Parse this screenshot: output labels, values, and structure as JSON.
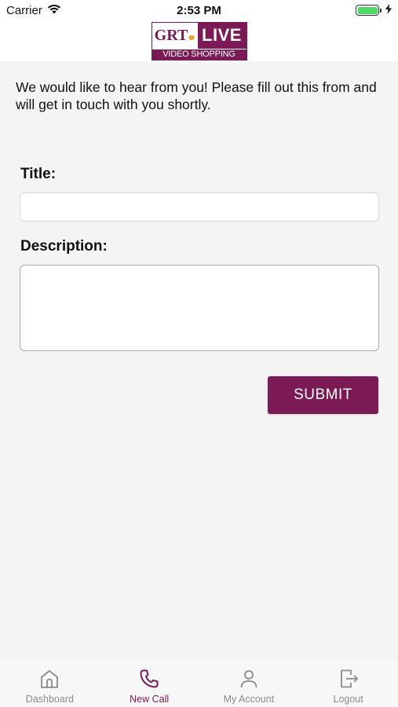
{
  "status_bar": {
    "carrier": "Carrier",
    "time": "2:53 PM",
    "battery_level": 1.0
  },
  "header": {
    "logo_text_grt": "GRT",
    "logo_text_live": "LIVE",
    "logo_text_sub": "VIDEO SHOPPING"
  },
  "form": {
    "intro": "We would like to hear from you! Please fill out this from and will get in touch with you shortly.",
    "title_label": "Title:",
    "title_value": "",
    "description_label": "Description:",
    "description_value": "",
    "submit_label": "SUBMIT"
  },
  "tabs": [
    {
      "label": "Dashboard",
      "icon": "home-icon",
      "active": false
    },
    {
      "label": "New Call",
      "icon": "phone-icon",
      "active": true
    },
    {
      "label": "My Account",
      "icon": "person-icon",
      "active": false
    },
    {
      "label": "Logout",
      "icon": "logout-icon",
      "active": false
    }
  ],
  "colors": {
    "brand": "#7b1a55",
    "inactive": "#8a8a8a",
    "background": "#f4f4f4",
    "battery": "#4cd964"
  }
}
